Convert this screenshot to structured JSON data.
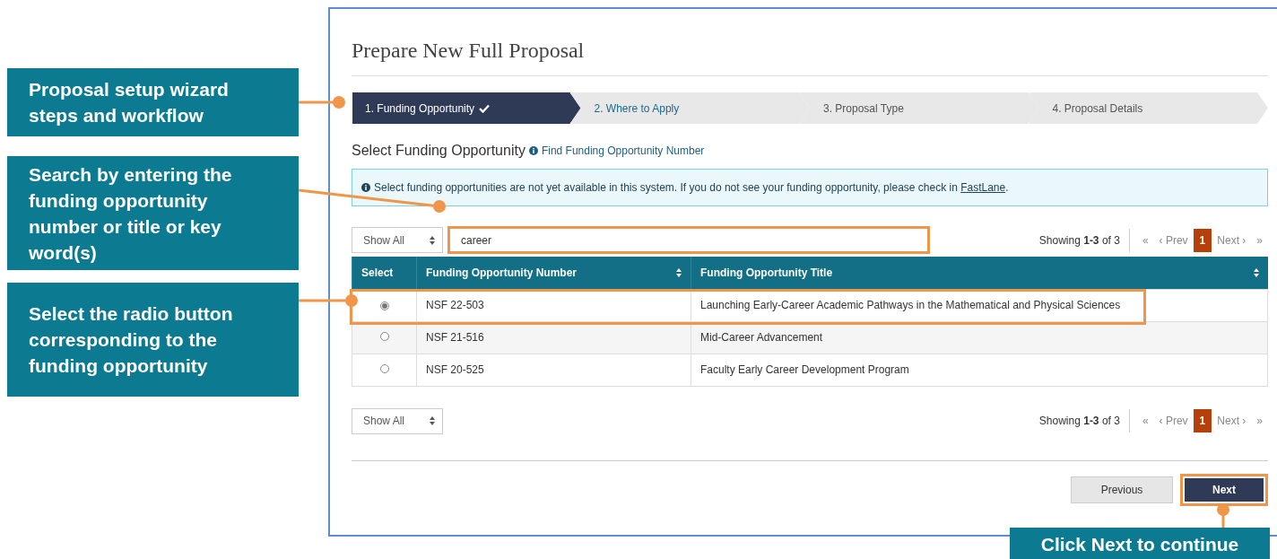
{
  "callouts": [
    {
      "text": "Proposal setup wizard steps and workflow"
    },
    {
      "text": "Search by entering the funding opportunity number or title or key word(s)"
    },
    {
      "text": "Select the radio button corresponding to the funding opportunity"
    },
    {
      "text": "Click Next to continue"
    }
  ],
  "page_title": "Prepare New Full Proposal",
  "steps": [
    {
      "label": "1. Funding Opportunity",
      "selected": true,
      "completed": true
    },
    {
      "label": "2. Where to Apply",
      "selected": false,
      "completed": false
    },
    {
      "label": "3. Proposal Type",
      "selected": false,
      "completed": false
    },
    {
      "label": "4. Proposal Details",
      "selected": false,
      "completed": false
    }
  ],
  "section_title": "Select Funding Opportunity",
  "help_link": "Find Funding Opportunity Number",
  "alert": {
    "text": "Select funding opportunities are not yet available in this system. If you do not see your funding opportunity, please check in",
    "link": "FastLane",
    "suffix": "."
  },
  "top_controls": {
    "page_size": "Show All",
    "search_value": "career",
    "showing": "Showing **1-3** of 3",
    "first": "«",
    "prev": "‹ Prev",
    "pages": [
      {
        "label": "1",
        "selected": true
      }
    ],
    "next": "Next ›",
    "last": "»"
  },
  "table": {
    "columns": [
      {
        "label": "Select",
        "sortable": false
      },
      {
        "label": "Funding Opportunity Number",
        "sortable": true
      },
      {
        "label": "Funding Opportunity Title",
        "sortable": true
      }
    ],
    "rows": [
      {
        "selected": true,
        "number": "NSF 22-503",
        "title": "Launching Early-Career Academic Pathways in the Mathematical and Physical Sciences"
      },
      {
        "selected": false,
        "number": "NSF 21-516",
        "title": "Mid-Career Advancement"
      },
      {
        "selected": false,
        "number": "NSF 20-525",
        "title": "Faculty Early Career Development Program"
      }
    ]
  },
  "bottom_controls": {
    "page_size": "Show All",
    "showing": "Showing **1-3** of 3",
    "first": "«",
    "prev": "‹ Prev",
    "pages": [
      {
        "label": "1",
        "selected": true
      }
    ],
    "next": "Next ›",
    "last": "»"
  },
  "buttons": {
    "previous": "Previous",
    "next": "Next"
  }
}
